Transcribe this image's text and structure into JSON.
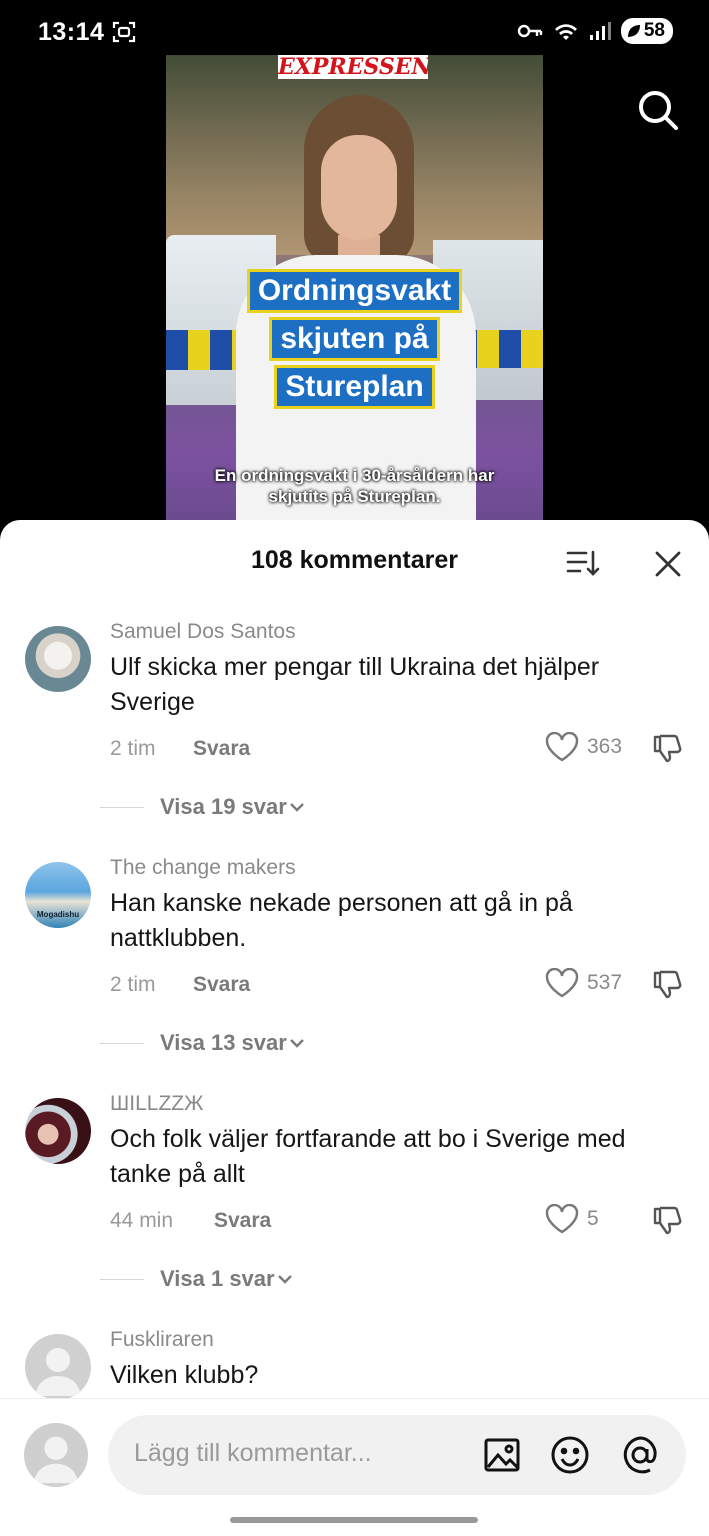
{
  "status_bar": {
    "time": "13:14",
    "battery": "58"
  },
  "video": {
    "brand": "EXPRESSEN",
    "headline_lines": [
      "Ordningsvakt",
      "skjuten på",
      "Stureplan"
    ],
    "subtitle": "En ordningsvakt i 30-årsåldern har skjutits på Stureplan."
  },
  "sheet": {
    "title": "108 kommentarer"
  },
  "comments": [
    {
      "user": "Samuel Dos Santos",
      "text": "Ulf skicka mer pengar till Ukraina det hjälper Sverige",
      "time": "2 tim",
      "reply": "Svara",
      "likes": "363",
      "view_replies": "Visa 19 svar"
    },
    {
      "user": "The change makers",
      "text": "Han kanske nekade personen att gå in på nattklubben.",
      "time": "2 tim",
      "reply": "Svara",
      "likes": "537",
      "view_replies": "Visa 13 svar",
      "avatar_caption": "Mogadishu"
    },
    {
      "user": "ШILLZZЖ",
      "text": "Och folk väljer fortfarande att bo i Sverige med tanke på allt",
      "time": "44 min",
      "reply": "Svara",
      "likes": "5",
      "view_replies": "Visa 1 svar"
    },
    {
      "user": "Fuskliraren",
      "text": "Vilken klubb?"
    }
  ],
  "input": {
    "placeholder": "Lägg till kommentar..."
  }
}
